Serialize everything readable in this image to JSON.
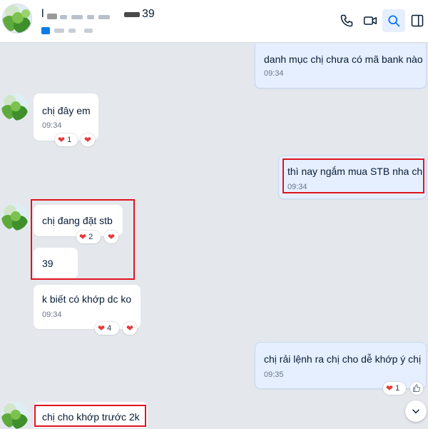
{
  "header": {
    "title_visible": "l",
    "title_suffix": "39",
    "actions": [
      "phone-icon",
      "video-call-icon",
      "search-icon",
      "sidebar-toggle-icon"
    ]
  },
  "messages": [
    {
      "id": "m1",
      "direction": "out",
      "text": "danh mục chị chưa có mã bank nào",
      "time": "09:34"
    },
    {
      "id": "m2",
      "direction": "in",
      "text": "chị đây em",
      "time": "09:34",
      "reaction_count": "1"
    },
    {
      "id": "m3",
      "direction": "out",
      "text": "thì nay ngắm mua STB nha chị",
      "time": "09:34",
      "highlighted": true
    },
    {
      "id": "m4",
      "direction": "in",
      "text": "chị đang đặt stb",
      "reaction_count": "2",
      "highlighted": true
    },
    {
      "id": "m5",
      "direction": "in",
      "text": "39",
      "highlighted": true
    },
    {
      "id": "m6",
      "direction": "in",
      "text": "k biết có khớp dc ko",
      "time": "09:34",
      "reaction_count": "4"
    },
    {
      "id": "m7",
      "direction": "out",
      "text": "chị rải lệnh ra chị cho dễ khớp ý chị",
      "time": "09:35",
      "reaction_count": "1"
    },
    {
      "id": "m8",
      "direction": "in",
      "text": "chị cho khớp trước 2k",
      "highlighted": true
    }
  ],
  "colors": {
    "accent": "#0068ff",
    "highlight": "#e0141e",
    "heart": "#e5393c",
    "out_bubble": "#e5efff",
    "background": "#e4e8ed"
  }
}
